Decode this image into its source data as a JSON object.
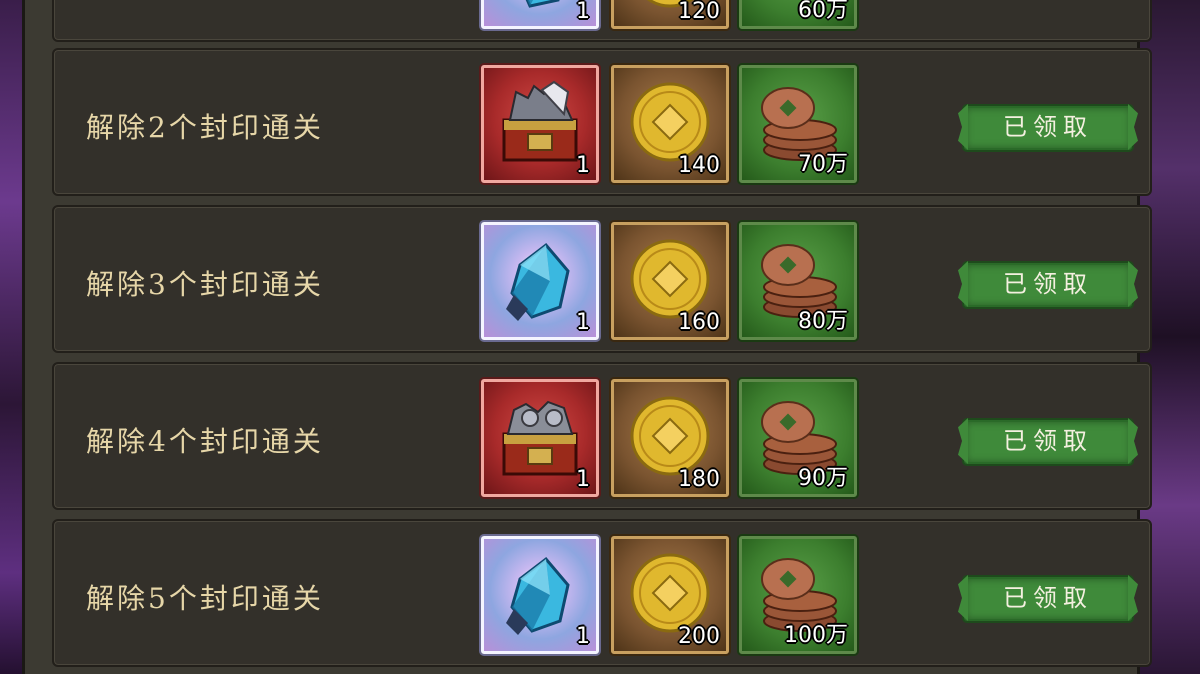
{
  "colors": {
    "panel_bg": "#33302a",
    "label_gold": "#e6d6a8",
    "claim_green": "#3f8a3a"
  },
  "rows": [
    {
      "label": "",
      "partial": true,
      "items": [
        {
          "icon": "blue-crystal-icon",
          "qty": "1"
        },
        {
          "icon": "gold-coin-icon",
          "qty": "120"
        },
        {
          "icon": "copper-coins-icon",
          "qty": "60万"
        }
      ],
      "claim_label": ""
    },
    {
      "label": "解除2个封印通关",
      "items": [
        {
          "icon": "equipment-chest-icon",
          "qty": "1"
        },
        {
          "icon": "gold-coin-icon",
          "qty": "140"
        },
        {
          "icon": "copper-coins-icon",
          "qty": "70万"
        }
      ],
      "claim_label": "已领取"
    },
    {
      "label": "解除3个封印通关",
      "items": [
        {
          "icon": "blue-crystal-icon",
          "qty": "1"
        },
        {
          "icon": "gold-coin-icon",
          "qty": "160"
        },
        {
          "icon": "copper-coins-icon",
          "qty": "80万"
        }
      ],
      "claim_label": "已领取"
    },
    {
      "label": "解除4个封印通关",
      "items": [
        {
          "icon": "equipment-chest-icon",
          "qty": "1"
        },
        {
          "icon": "gold-coin-icon",
          "qty": "180"
        },
        {
          "icon": "copper-coins-icon",
          "qty": "90万"
        }
      ],
      "claim_label": "已领取"
    },
    {
      "label": "解除5个封印通关",
      "items": [
        {
          "icon": "blue-crystal-icon",
          "qty": "1"
        },
        {
          "icon": "gold-coin-icon",
          "qty": "200"
        },
        {
          "icon": "copper-coins-icon",
          "qty": "100万"
        }
      ],
      "claim_label": "已领取"
    }
  ]
}
